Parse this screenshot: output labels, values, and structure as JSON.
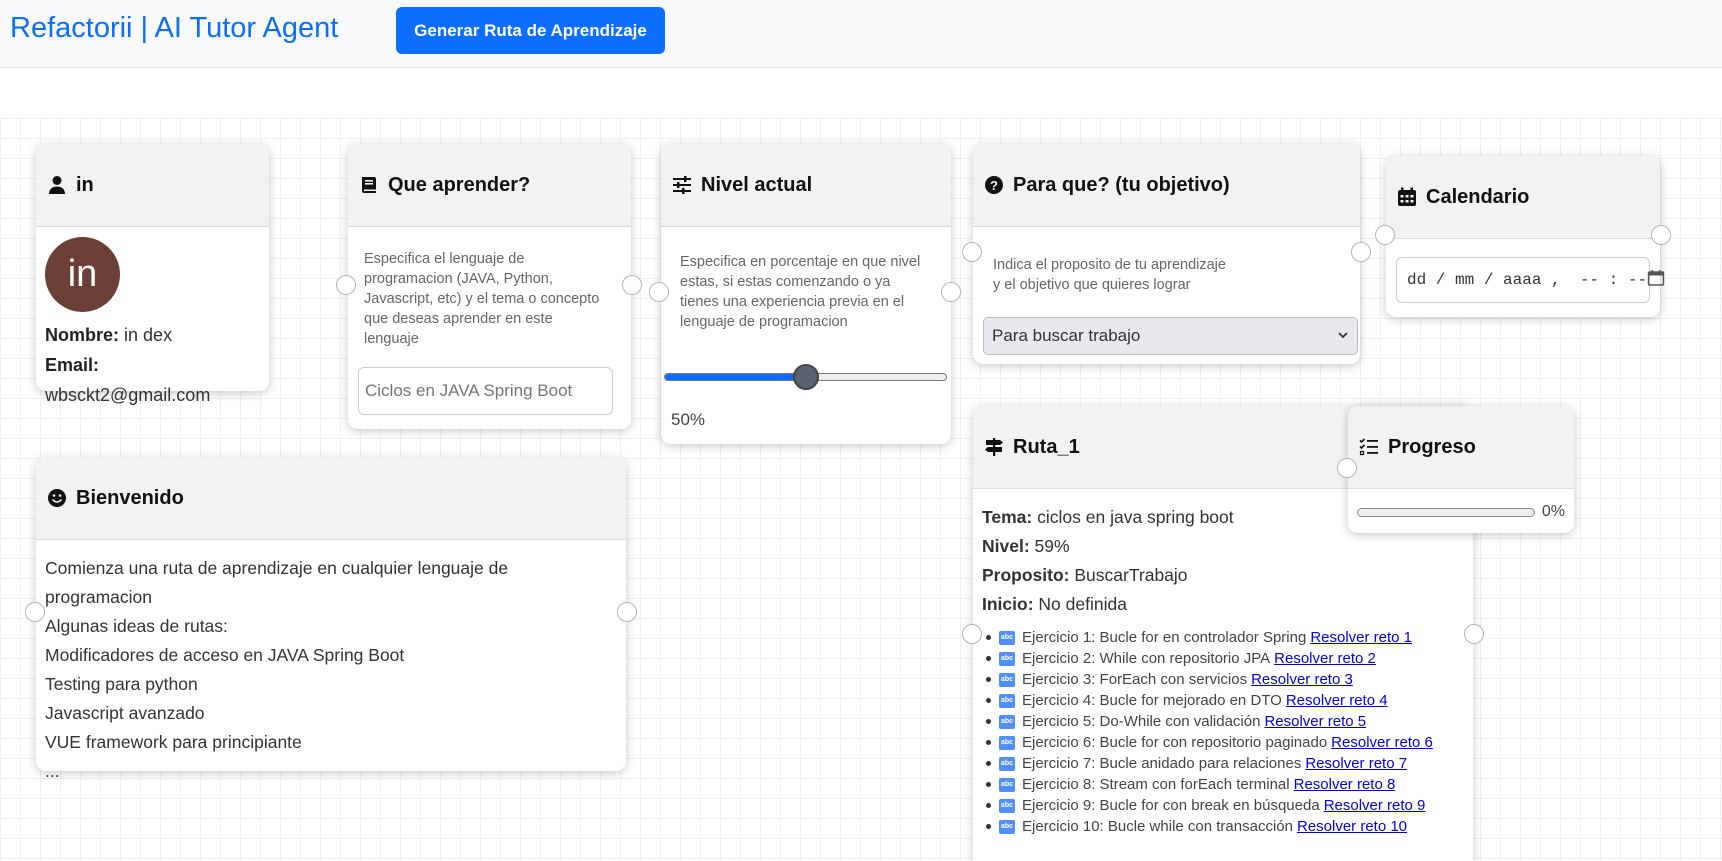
{
  "app": {
    "title": "Refactorii | AI Tutor Agent",
    "generate_button": "Generar Ruta de Aprendizaje",
    "accent_color": "#0d6efd"
  },
  "user_node": {
    "title": "in",
    "icon": "user-icon",
    "avatar_text": "in",
    "avatar_color": "#6b3f35",
    "name_label": "Nombre:",
    "name_value": "in dex",
    "email_label": "Email:",
    "email_value": "wbsckt2@gmail.com"
  },
  "learn_node": {
    "title": "Que aprender?",
    "icon": "book-icon",
    "description": "Especifica el lenguaje de programacion (JAVA, Python, Javascript, etc) y el tema o concepto que deseas aprender en este lenguaje",
    "input_placeholder": "Ciclos en JAVA Spring Boot"
  },
  "level_node": {
    "title": "Nivel actual",
    "icon": "sliders-icon",
    "description": "Especifica en porcentaje en que nivel estas, si estas comenzando o ya tienes una experiencia previa en el lenguaje de programacion",
    "slider_value": 50,
    "value_label": "50%"
  },
  "goal_node": {
    "title": "Para que? (tu objetivo)",
    "icon": "question-circle-icon",
    "description_line1": "Indica el proposito de tu aprendizaje",
    "description_line2": "y el objetivo que quieres lograr",
    "selected_option": "Para buscar trabajo"
  },
  "calendar_node": {
    "title": "Calendario",
    "icon": "calendar-icon",
    "date_placeholder": "dd / mm / aaaa ,  -- : --"
  },
  "welcome_node": {
    "title": "Bienvenido",
    "icon": "smile-icon",
    "lines": [
      "Comienza una ruta de aprendizaje en cualquier lenguaje de programacion",
      "Algunas ideas de rutas:",
      "Modificadores de acceso en JAVA Spring Boot",
      "Testing para python",
      "Javascript avanzado",
      "VUE framework para principiante",
      "..."
    ]
  },
  "route_node": {
    "title": "Ruta_1",
    "icon": "signpost-icon",
    "tema_label": "Tema:",
    "tema_value": "ciclos en java spring boot",
    "nivel_label": "Nivel:",
    "nivel_value": "59%",
    "proposito_label": "Proposito:",
    "proposito_value": "BuscarTrabajo",
    "inicio_label": "Inicio:",
    "inicio_value": "No definida",
    "exercises": [
      {
        "text": "Ejercicio 1: Bucle for en controlador Spring",
        "link": "Resolver reto 1"
      },
      {
        "text": "Ejercicio 2: While con repositorio JPA",
        "link": "Resolver reto 2"
      },
      {
        "text": "Ejercicio 3: ForEach con servicios",
        "link": "Resolver reto 3"
      },
      {
        "text": "Ejercicio 4: Bucle for mejorado en DTO",
        "link": "Resolver reto 4"
      },
      {
        "text": "Ejercicio 5: Do-While con validación",
        "link": "Resolver reto 5"
      },
      {
        "text": "Ejercicio 6: Bucle for con repositorio paginado",
        "link": "Resolver reto 6"
      },
      {
        "text": "Ejercicio 7: Bucle anidado para relaciones",
        "link": "Resolver reto 7"
      },
      {
        "text": "Ejercicio 8: Stream con forEach terminal",
        "link": "Resolver reto 8"
      },
      {
        "text": "Ejercicio 9: Bucle for con break en búsqueda",
        "link": "Resolver reto 9"
      },
      {
        "text": "Ejercicio 10: Bucle while con transacción",
        "link": "Resolver reto 10"
      }
    ]
  },
  "progress_node": {
    "title": "Progreso",
    "icon": "checklist-icon",
    "progress_value": 0,
    "progress_label": "0%"
  }
}
